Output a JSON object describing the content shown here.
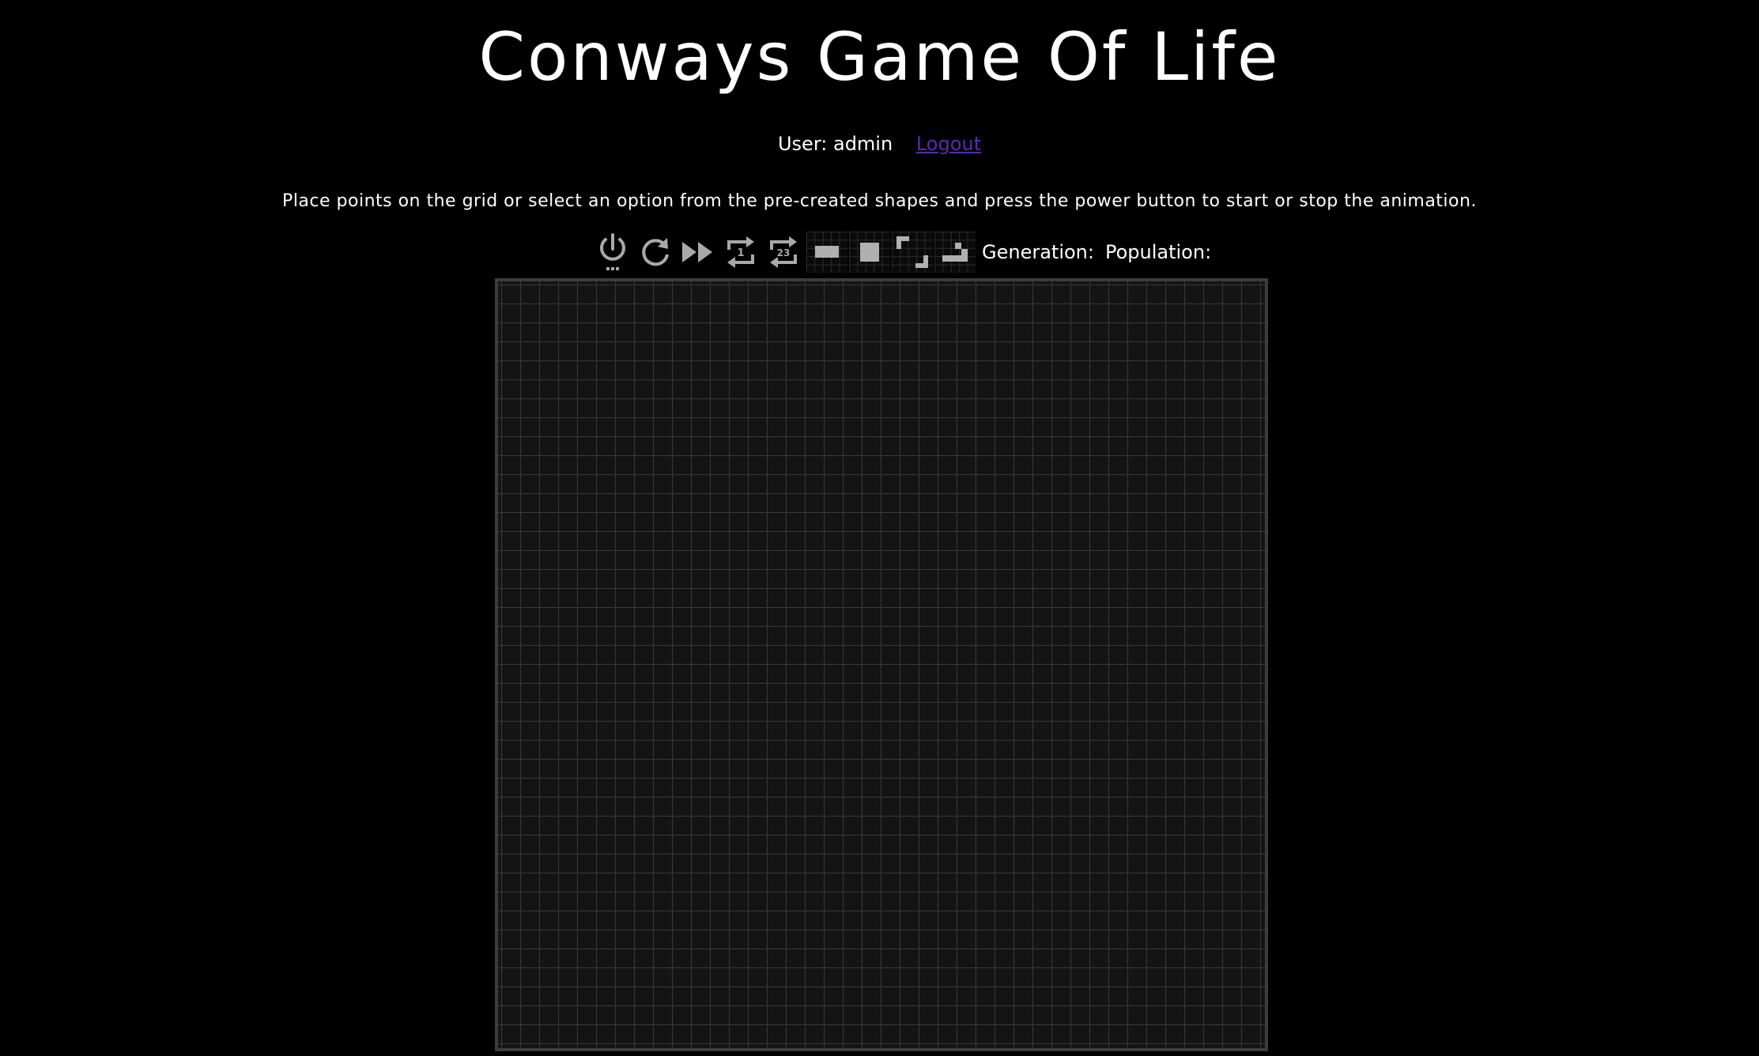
{
  "title": "Conways Game Of Life",
  "user": {
    "label": "User: admin",
    "logout_label": "Logout"
  },
  "instructions": "Place points on the grid or select an option from the pre-created shapes and press the power button to start or stop the animation.",
  "toolbar": {
    "buttons": [
      {
        "name": "power-button",
        "icon": "power-icon"
      },
      {
        "name": "reset-button",
        "icon": "refresh-icon"
      },
      {
        "name": "fast-forward-button",
        "icon": "fast-forward-icon"
      },
      {
        "name": "repeat-one-button",
        "icon": "repeat-one-icon",
        "badge": "1"
      },
      {
        "name": "repeat-23-button",
        "icon": "repeat-23-icon",
        "badge": "23"
      }
    ],
    "shapes": [
      {
        "name": "shape-blinker",
        "icon": "blinker-shape-icon"
      },
      {
        "name": "shape-block",
        "icon": "block-shape-icon"
      },
      {
        "name": "shape-beacon",
        "icon": "beacon-shape-icon"
      },
      {
        "name": "shape-glider",
        "icon": "glider-shape-icon"
      }
    ]
  },
  "stats": {
    "generation_label": "Generation:",
    "population_label": "Population:"
  },
  "colors": {
    "background": "#000000",
    "text": "#ffffff",
    "link": "#5b2bb0",
    "icon": "#a9a9a9",
    "grid_line": "#3a3a3a",
    "board_border": "#3c3c3c"
  }
}
